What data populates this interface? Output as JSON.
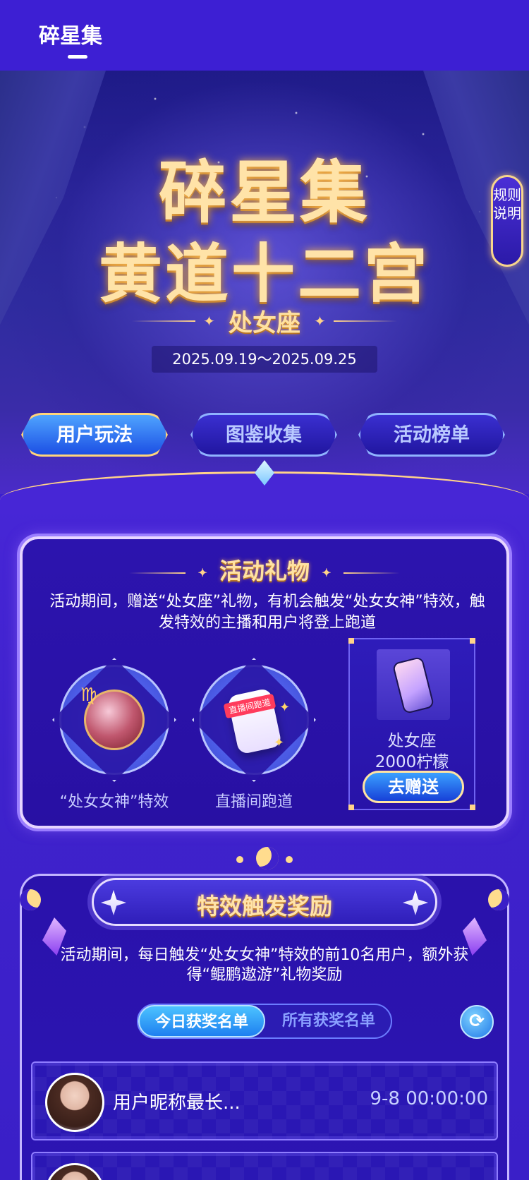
{
  "app": {
    "title": "碎星集"
  },
  "hero": {
    "title_line1": "碎星集",
    "title_line2": "黄道十二宫",
    "sign": "处女座",
    "date_range": "2025.09.19～2025.09.25",
    "rules_button": "规则说明"
  },
  "tabs": [
    {
      "label": "用户玩法",
      "active": true
    },
    {
      "label": "图鉴收集",
      "active": false
    },
    {
      "label": "活动榜单",
      "active": false
    }
  ],
  "gift_section": {
    "heading": "活动礼物",
    "description": "活动期间，赠送“处女座”礼物，有机会触发“处女女神”特效，触发特效的主播和用户将登上跑道",
    "items": [
      {
        "label": "“处女女神”特效",
        "icon": "virgo-goddess-icon",
        "symbol": "♍"
      },
      {
        "label": "直播间跑道",
        "icon": "live-runway-phone-icon",
        "tag": "直播间跑道"
      }
    ],
    "gift": {
      "name": "处女座",
      "price": "2000柠檬",
      "button": "去赠送"
    }
  },
  "reward_section": {
    "heading": "特效触发奖励",
    "description": "活动期间，每日触发“处女女神”特效的前10名用户，额外获得“鲲鹏遨游”礼物奖励",
    "toggle": {
      "today": "今日获奖名单",
      "all": "所有获奖名单",
      "selected": "today"
    },
    "refresh_icon": "refresh-icon",
    "rows": [
      {
        "nickname": "用户昵称最长...",
        "time": "9-8 00:00:00"
      }
    ]
  },
  "colors": {
    "background": "#3d1fd3",
    "gold": "#ffe3a8",
    "active_tab": "#1c4fe4"
  }
}
